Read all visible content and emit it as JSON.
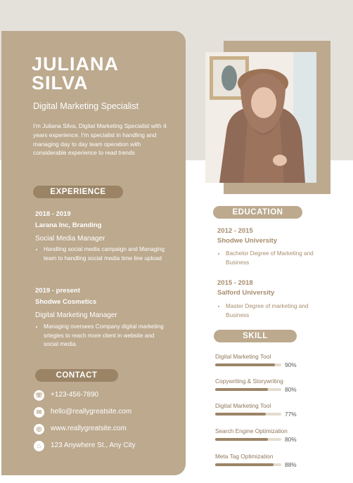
{
  "profile": {
    "first_name": "JULIANA",
    "last_name": "SILVA",
    "title": "Digital Marketing Specialist",
    "intro": "I'm Juliana Silva, Digital Marketing Specialist with 4 years experience. I'm specialist in handling and managing day to day team operation with considerable experience to read trends"
  },
  "experience": {
    "heading": "EXPERIENCE",
    "items": [
      {
        "years": "2018 - 2019",
        "company": "Larana Inc, Branding",
        "role": "Social Media Manager",
        "bullet": "Handling social media campaign and Managing team to handling social media time line upload"
      },
      {
        "years": "2019 - present",
        "company": "Shodwe Cosmetics",
        "role": "Digital Marketing Manager",
        "bullet": "Managing oversees Company digital marketing srtegies to reach more client in website and social media."
      }
    ]
  },
  "contact": {
    "heading": "CONTACT",
    "items": [
      {
        "icon": "phone-icon",
        "text": "+123-456-7890"
      },
      {
        "icon": "email-icon",
        "text": "hello@reallygreatsite.com"
      },
      {
        "icon": "globe-icon",
        "text": "www.reallygreatsite.com"
      },
      {
        "icon": "location-icon",
        "text": "123 Anywhere St., Any City"
      }
    ]
  },
  "education": {
    "heading": "EDUCATION",
    "items": [
      {
        "years": "2012 - 2015",
        "school": "Shodwe University",
        "degree": "Bachelor Degree of Marketing and Business"
      },
      {
        "years": "2015 - 2018",
        "school": "Salford University",
        "degree": "Master Degree of marketing and Business"
      }
    ]
  },
  "skills": {
    "heading": "SKILL",
    "items": [
      {
        "name": "Digital Marketing Tool",
        "percent": 90,
        "label": "90%"
      },
      {
        "name": "Copywriting & Storywriting",
        "percent": 80,
        "label": "80%"
      },
      {
        "name": "Digital Marketing Tool",
        "percent": 77,
        "label": "77%"
      },
      {
        "name": "Search Engine Optimization",
        "percent": 80,
        "label": "80%"
      },
      {
        "name": "Meta Tag Optimization",
        "percent": 88,
        "label": "88%"
      }
    ]
  },
  "colors": {
    "panel": "#bca98e",
    "accent": "#9b8466",
    "band": "#e4e1db",
    "text_brown": "#a78d6e"
  }
}
